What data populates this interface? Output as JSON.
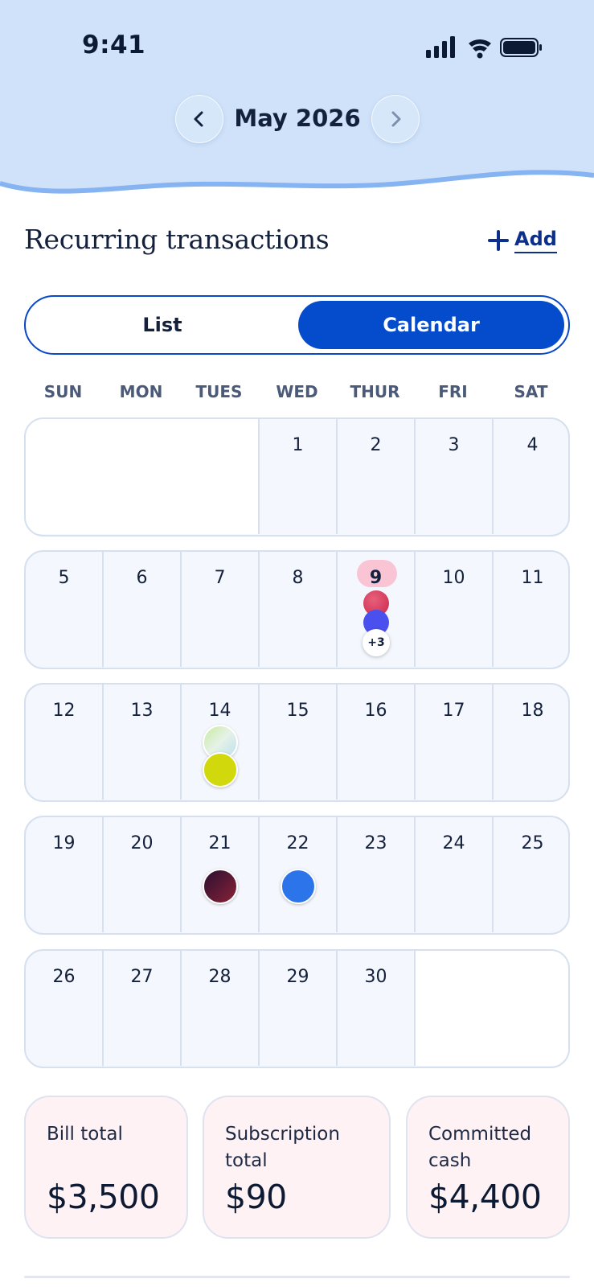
{
  "status": {
    "time": "9:41"
  },
  "month_nav": {
    "label": "May 2026"
  },
  "page": {
    "title": "Recurring transactions",
    "add_label": "Add"
  },
  "view_toggle": {
    "list_label": "List",
    "calendar_label": "Calendar",
    "selected": "Calendar"
  },
  "weekdays": [
    "SUN",
    "MON",
    "TUES",
    "WED",
    "THUR",
    "FRI",
    "SAT"
  ],
  "calendar": {
    "weeks": [
      [
        "",
        "",
        "",
        "1",
        "2",
        "3",
        "4"
      ],
      [
        "5",
        "6",
        "7",
        "8",
        "9",
        "10",
        "11"
      ],
      [
        "12",
        "13",
        "14",
        "15",
        "16",
        "17",
        "18"
      ],
      [
        "19",
        "20",
        "21",
        "22",
        "23",
        "24",
        "25"
      ],
      [
        "26",
        "27",
        "28",
        "29",
        "30",
        "",
        ""
      ]
    ],
    "today": "9",
    "more_label": "+3"
  },
  "summary": {
    "bill_label": "Bill total",
    "bill_value": "$3,500",
    "subscription_label": "Subscription total",
    "subscription_value": "$90",
    "committed_label": "Committed cash",
    "committed_value": "$4,400"
  },
  "colors": {
    "header_bg": "#cfe2f9",
    "wave": "#86b3f1",
    "accent": "#044ccc",
    "today_pill": "#f9c5d4",
    "card_bg": "#fff2f5"
  }
}
